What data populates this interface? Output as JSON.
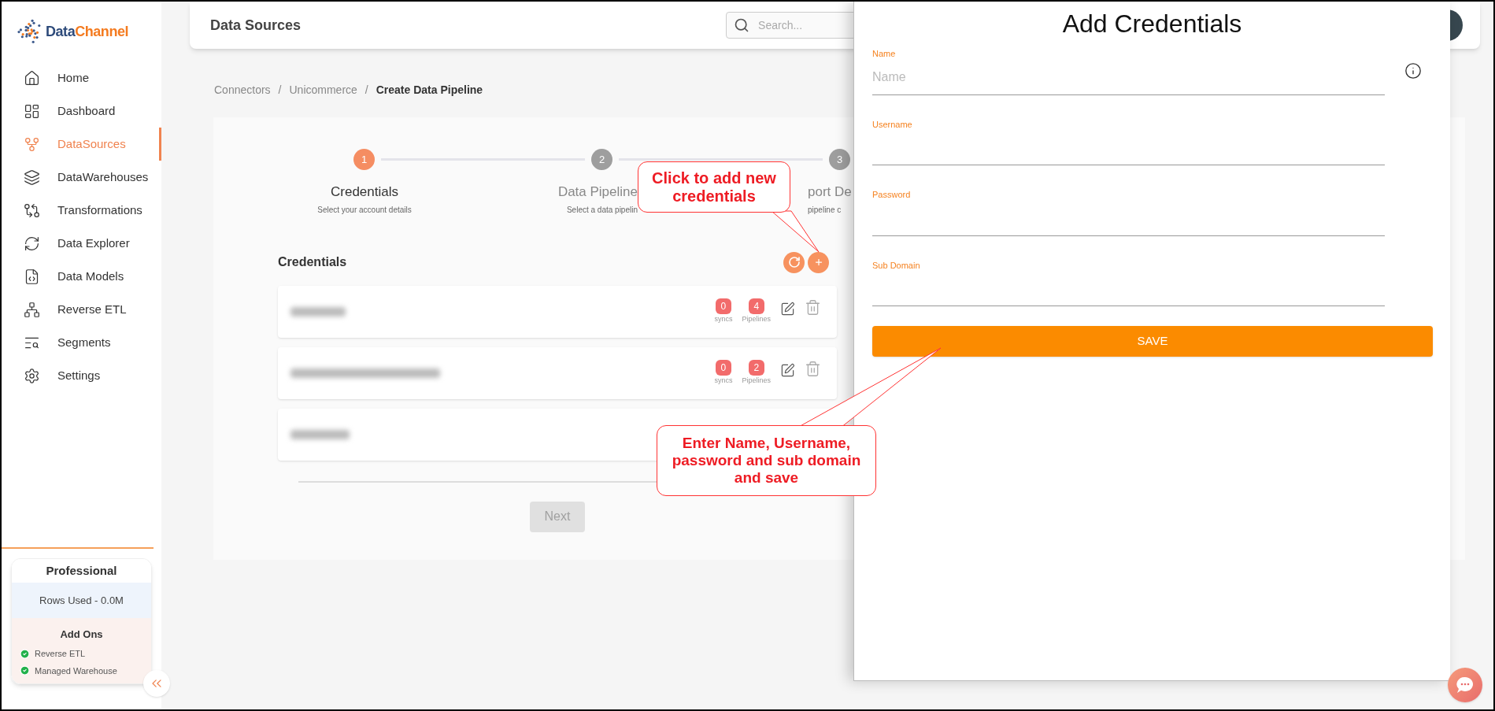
{
  "sidebar": {
    "logo": {
      "part_1": "Data",
      "part_2": "Channel"
    },
    "items": [
      {
        "label": "Home",
        "selected": false
      },
      {
        "label": "Dashboard",
        "selected": false
      },
      {
        "label": "DataSources",
        "selected": true
      },
      {
        "label": "DataWarehouses",
        "selected": false
      },
      {
        "label": "Transformations",
        "selected": false
      },
      {
        "label": "Data Explorer",
        "selected": false
      },
      {
        "label": "Data Models",
        "selected": false
      },
      {
        "label": "Reverse ETL",
        "selected": false
      },
      {
        "label": "Segments",
        "selected": false
      },
      {
        "label": "Settings",
        "selected": false
      }
    ],
    "plan": {
      "title": "Professional",
      "rows_used": "Rows Used - 0.0M",
      "addons_title": "Add Ons",
      "addons": [
        {
          "label": "Reverse ETL",
          "enabled": true
        },
        {
          "label": "Managed Warehouse",
          "enabled": true
        }
      ]
    }
  },
  "header": {
    "title": "Data Sources",
    "search": {
      "placeholder": "Search..."
    }
  },
  "breadcrumb": {
    "separator": "/",
    "items": [
      {
        "label": "Connectors",
        "current": false
      },
      {
        "label": "Unicommerce",
        "current": false
      },
      {
        "label": "Create Data Pipeline",
        "current": true
      }
    ]
  },
  "stepper": [
    {
      "number": "1",
      "title": "Credentials",
      "subtitle": "Select your account details",
      "active": true
    },
    {
      "number": "2",
      "title": "Data Pipeline",
      "subtitle": "Select a data pipelin",
      "active": false
    },
    {
      "number": "3",
      "title": "port De",
      "subtitle": "pipeline c",
      "active": false
    }
  ],
  "credentials": {
    "title": "Credentials",
    "rows": [
      {
        "kind": "counts",
        "syncs": "0",
        "syncs_label": "syncs",
        "pipelines": "4",
        "pipelines_label": "Pipelines"
      },
      {
        "kind": "counts",
        "syncs": "0",
        "syncs_label": "syncs",
        "pipelines": "2",
        "pipelines_label": "Pipelines"
      },
      {
        "kind": "plain"
      }
    ]
  },
  "next_button": {
    "label": "Next",
    "disabled": true
  },
  "drawer": {
    "title": "Add Credentials",
    "fields": [
      {
        "label": "Name",
        "placeholder": "Name"
      },
      {
        "label": "Username"
      },
      {
        "label": "Password"
      },
      {
        "label": "Sub Domain"
      }
    ],
    "save_button": "SAVE"
  },
  "callouts": [
    {
      "text": "Click to add new credentials"
    },
    {
      "text": "Enter Name, Username, password and sub domain and save"
    }
  ]
}
